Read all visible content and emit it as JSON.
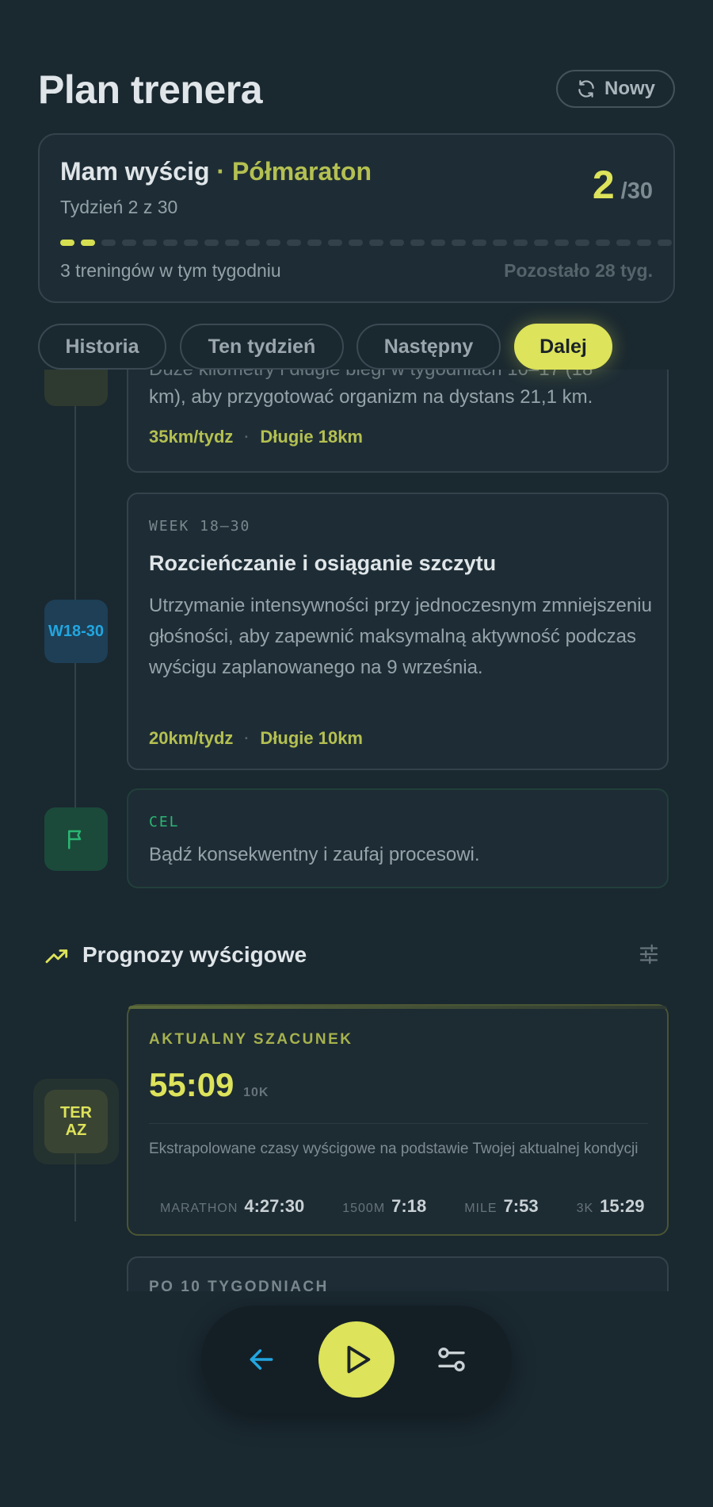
{
  "header": {
    "title": "Plan trenera",
    "new_button": "Nowy"
  },
  "plan": {
    "title": "Mam wyścig",
    "separator": " · ",
    "race": "Półmaraton",
    "week_text": "Tydzień 2 z 30",
    "current_week": "2",
    "total_weeks": "/30",
    "progress": {
      "completed": 2,
      "total": 30
    },
    "workouts_text": "3 treningów w tym tygodniu",
    "remaining_text": "Pozostało 28 tyg."
  },
  "tabs": [
    {
      "label": "Historia"
    },
    {
      "label": "Ten tydzień"
    },
    {
      "label": "Następny"
    },
    {
      "label": "Dalej",
      "active": true
    }
  ],
  "timeline": {
    "phase_partial": {
      "text": "km), aby przygotować organizm na dystans 21,1 km.",
      "weekly": "35km/tydz",
      "long": "Długie 18km"
    },
    "phase_taper": {
      "marker": "W18-30",
      "label": "WEEK 18–30",
      "title": "Rozcieńczanie i osiąganie szczytu",
      "text": "Utrzymanie intensywności przy jednoczesnym zmniejszeniu głośności, aby zapewnić maksymalną aktywność podczas wyścigu zaplanowanego na 9 września.",
      "weekly": "20km/tydz",
      "long": "Długie 10km"
    },
    "goal": {
      "label": "CEL",
      "text": "Bądź konsekwentny i zaufaj procesowi.",
      "icon": "flag-icon"
    }
  },
  "predictions": {
    "title": "Prognozy wyścigowe",
    "current": {
      "marker": "TERAZ",
      "label": "AKTUALNY SZACUNEK",
      "time": "55:09",
      "unit": "10K",
      "desc": "Ekstrapolowane czasy wyścigowe na podstawie Twojej aktualnej kondycji",
      "items": [
        {
          "label": "MARATHON",
          "value": "4:27:30"
        },
        {
          "label": "1500M",
          "value": "7:18"
        },
        {
          "label": "MILE",
          "value": "7:53"
        },
        {
          "label": "3K",
          "value": "15:29"
        }
      ]
    },
    "next_label": "PO 10 TYGODNIACH"
  },
  "colors": {
    "accent": "#dde35a",
    "olive": "#b4c051",
    "blue": "#22a6e0",
    "green": "#2bb673",
    "bg": "#1a2830"
  }
}
